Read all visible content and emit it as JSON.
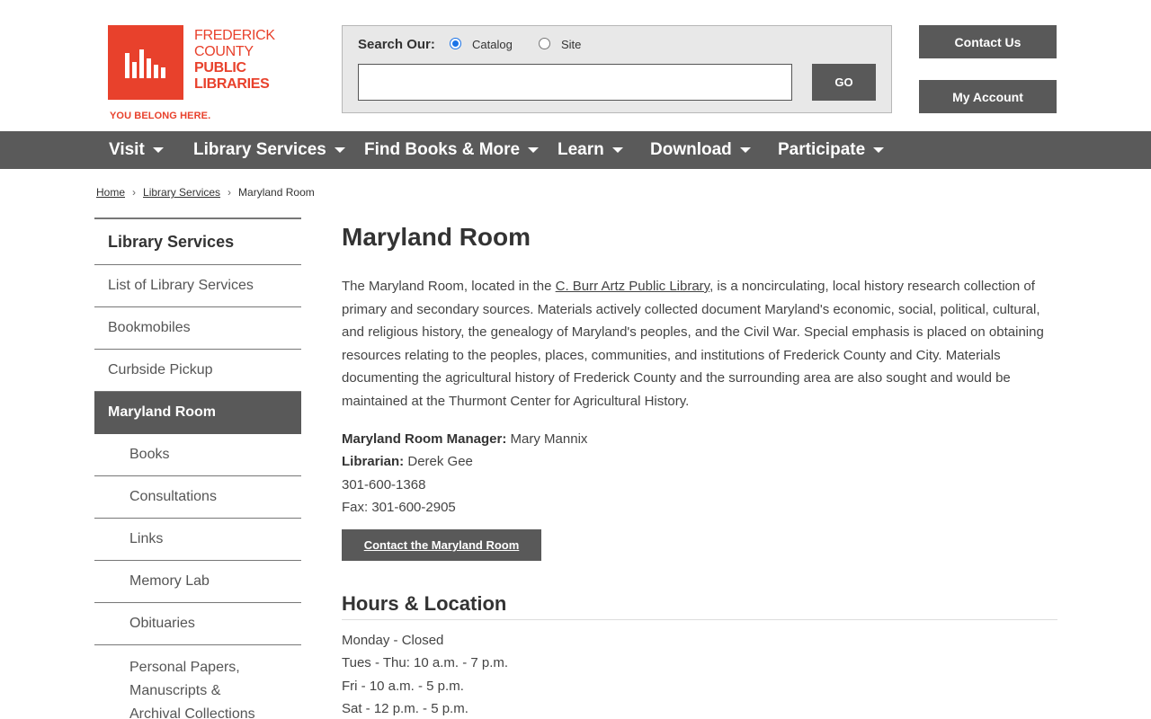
{
  "logo": {
    "line1": "FREDERICK",
    "line2": "COUNTY",
    "line3": "PUBLIC",
    "line4": "LIBRARIES",
    "tagline": "YOU BELONG HERE.",
    "brand_color": "#e8412c"
  },
  "search": {
    "label": "Search Our:",
    "options": [
      "Catalog",
      "Site"
    ],
    "selected": "Catalog",
    "value": "",
    "go_label": "GO"
  },
  "header_buttons": {
    "contact": "Contact Us",
    "account": "My Account"
  },
  "nav": {
    "items": [
      "Visit",
      "Library Services",
      "Find Books & More",
      "Learn",
      "Download",
      "Participate"
    ]
  },
  "breadcrumb": {
    "items": [
      "Home",
      "Library Services",
      "Maryland Room"
    ],
    "separator": "›"
  },
  "sidebar": {
    "heading": "Library Services",
    "items": [
      "List of Library Services",
      "Bookmobiles",
      "Curbside Pickup",
      "Maryland Room",
      "Books",
      "Consultations",
      "Links",
      "Memory Lab",
      "Obituaries",
      "Personal Papers, Manuscripts & Archival Collections"
    ],
    "active": "Maryland Room"
  },
  "main": {
    "title": "Maryland Room",
    "intro_before_link": "The Maryland Room, located in the ",
    "intro_link": "C. Burr Artz Public Library",
    "intro_after_link": ", is a noncirculating, local history research collection of primary and secondary sources. Materials actively collected document Maryland's economic, social, political, cultural, and religious history, the genealogy of Maryland's peoples, and the Civil War. Special emphasis is placed on obtaining resources relating to the peoples, places, communities, and institutions of Frederick County and City. Materials documenting the agricultural history of Frederick County and the surrounding area are also sought and would be maintained at the Thurmont Center for Agricultural History.",
    "manager_label": "Maryland Room Manager:",
    "manager_name": "Mary Mannix",
    "librarian_label": "Librarian:",
    "librarian_name": "Derek Gee",
    "phone": "301-600-1368",
    "fax": "Fax: 301-600-2905",
    "contact_button": "Contact the Maryland Room",
    "hours_title": "Hours & Location",
    "hours": [
      "Monday - Closed",
      "Tues - Thu: 10 a.m. - 7 p.m.",
      "Fri - 10 a.m. - 5 p.m.",
      "Sat - 12 p.m. - 5 p.m."
    ]
  },
  "colors": {
    "nav_bg": "#5a5a5a",
    "button_bg": "#595959",
    "accent": "#e8412c"
  }
}
